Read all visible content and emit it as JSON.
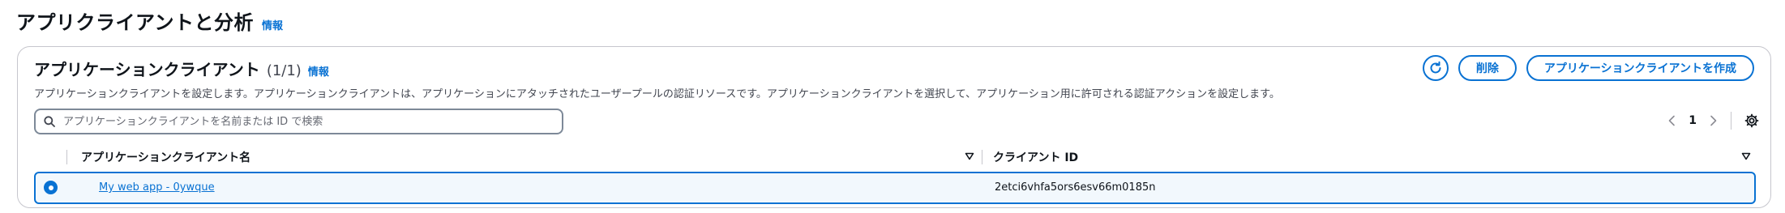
{
  "page": {
    "title": "アプリクライアントと分析",
    "info": "情報"
  },
  "panel": {
    "title": "アプリケーションクライアント",
    "count": "(1/1)",
    "info": "情報",
    "description": "アプリケーションクライアントを設定します。アプリケーションクライアントは、アプリケーションにアタッチされたユーザープールの認証リソースです。アプリケーションクライアントを選択して、アプリケーション用に許可される認証アクションを設定します。"
  },
  "actions": {
    "refresh_icon": "refresh-icon",
    "delete_label": "削除",
    "create_label": "アプリケーションクライアントを作成"
  },
  "search": {
    "placeholder": "アプリケーションクライアントを名前または ID で検索",
    "value": ""
  },
  "pagination": {
    "current_page": "1"
  },
  "table": {
    "columns": [
      {
        "label": "アプリケーションクライアント名"
      },
      {
        "label": "クライアント ID"
      }
    ],
    "rows": [
      {
        "selected": true,
        "name": "My web app - 0ywque",
        "client_id": "2etci6vhfa5ors6esv66m0185n"
      }
    ]
  },
  "colors": {
    "accent": "#0972d3",
    "text": "#0f141a",
    "muted": "#424650",
    "border": "#c6c6cd"
  }
}
